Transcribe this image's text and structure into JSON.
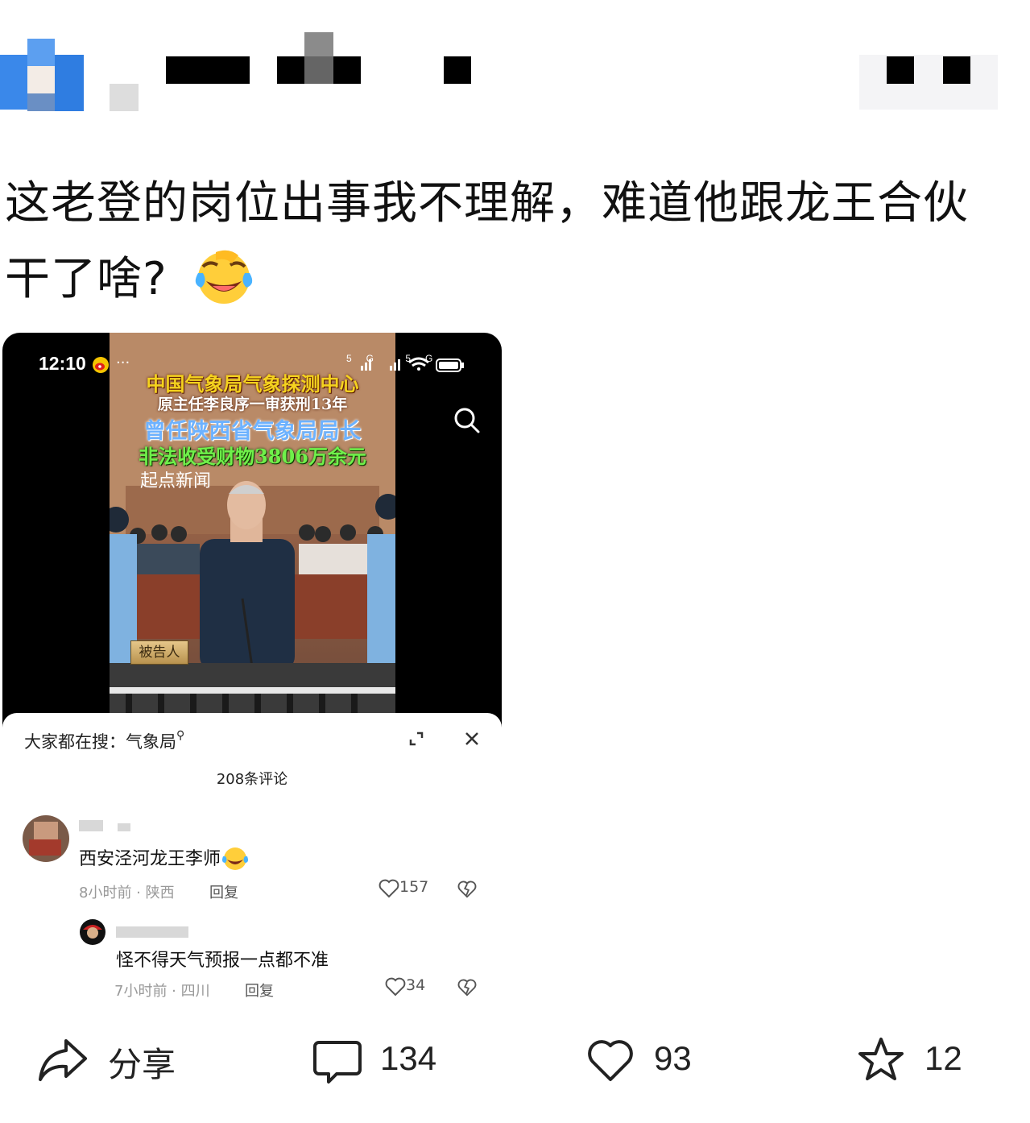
{
  "post": {
    "text_line1": "这老登的岗位出事我不理解，难道他跟龙王合伙",
    "text_line2": "干了啥?",
    "emoji": "rofl-emoji"
  },
  "embed": {
    "status_time": "12:10",
    "status_dots": "···",
    "status_network": "5G 5G",
    "video": {
      "headline_1": "中国气象局气象探测中心",
      "headline_2": "原主任李良序一审获刑13年",
      "headline_3": "曾任陕西省气象局局长",
      "headline_4": "非法收受财物3806万余元",
      "source": "起点新闻",
      "defendant_label": "被告人"
    },
    "search_prefix": "大家都在搜：",
    "search_term": "气象局",
    "comment_count": "208条评论",
    "comments": [
      {
        "text": "西安泾河龙王李师",
        "time": "8小时前",
        "location": "陕西",
        "reply": "回复",
        "likes": "157"
      },
      {
        "text": "怪不得天气预报一点都不准",
        "time": "7小时前",
        "location": "四川",
        "reply": "回复",
        "likes": "34"
      }
    ]
  },
  "actions": {
    "share": "分享",
    "comments": "134",
    "likes": "93",
    "favorites": "12"
  },
  "colors": {
    "headline_yellow": "#f4d21f",
    "headline_blue": "#6db2ff",
    "headline_green": "#6ff04a",
    "avatar_blue": "#2f7de1"
  }
}
